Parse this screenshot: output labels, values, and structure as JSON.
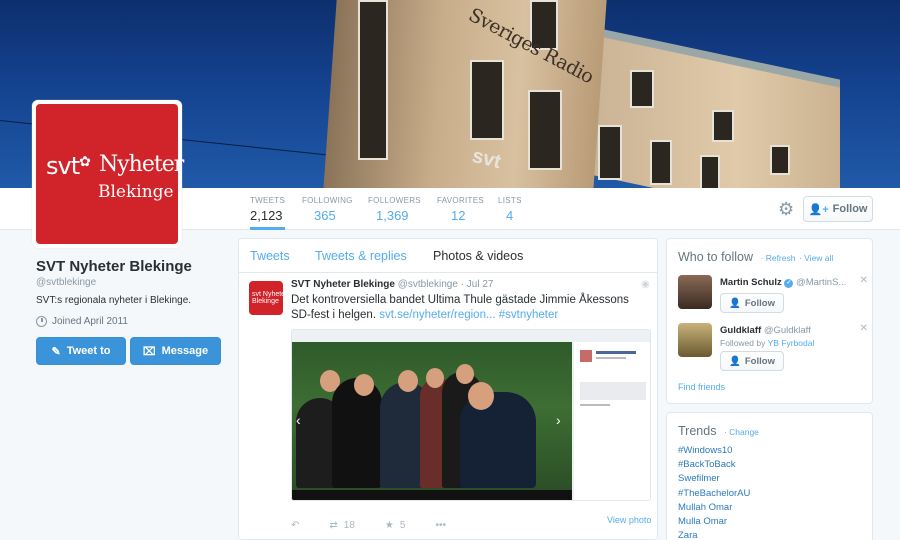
{
  "header": {
    "sign_text": "Sveriges Radio",
    "sign_svt": "svt"
  },
  "avatar": {
    "svt": "svt",
    "nyheter": "Nyheter",
    "region": "Blekinge"
  },
  "stats": [
    {
      "label": "TWEETS",
      "value": "2,123"
    },
    {
      "label": "FOLLOWING",
      "value": "365"
    },
    {
      "label": "FOLLOWERS",
      "value": "1,369"
    },
    {
      "label": "FAVORITES",
      "value": "12"
    },
    {
      "label": "LISTS",
      "value": "4"
    }
  ],
  "follow_button": "Follow",
  "profile": {
    "name": "SVT Nyheter Blekinge",
    "handle": "@svtblekinge",
    "bio": "SVT:s regionala nyheter i Blekinge.",
    "joined": "Joined April 2011",
    "tweet_to": "Tweet to",
    "message": "Message"
  },
  "tabs": [
    "Tweets",
    "Tweets & replies",
    "Photos & videos"
  ],
  "tweet": {
    "name": "SVT Nyheter Blekinge",
    "handle": "@svtblekinge",
    "date": "· Jul 27",
    "text": "Det kontroversiella bandet Ultima Thule gästade Jimmie Åkessons SD-fest i helgen.",
    "link": "svt.se/nyheter/region...",
    "hashtag": "#svtnyheter",
    "retweets": "18",
    "favorites": "5",
    "view_photo": "View photo"
  },
  "who_to_follow": {
    "title": "Who to follow",
    "refresh": "· Refresh",
    "view_all": "· View all",
    "users": [
      {
        "name": "Martin Schulz",
        "handle": "@MartinS...",
        "sub": "",
        "follow": "Follow"
      },
      {
        "name": "Guldklaff",
        "handle": "@Guldklaff",
        "sub": "Followed by",
        "sub_link": "YB Fyrbodal",
        "follow": "Follow"
      }
    ],
    "find_friends": "Find friends"
  },
  "trends": {
    "title": "Trends",
    "change": "· Change",
    "items": [
      "#Windows10",
      "#BackToBack",
      "Swefilmer",
      "#TheBachelorAU",
      "Mullah Omar",
      "Mulla Omar",
      "Zara"
    ]
  }
}
